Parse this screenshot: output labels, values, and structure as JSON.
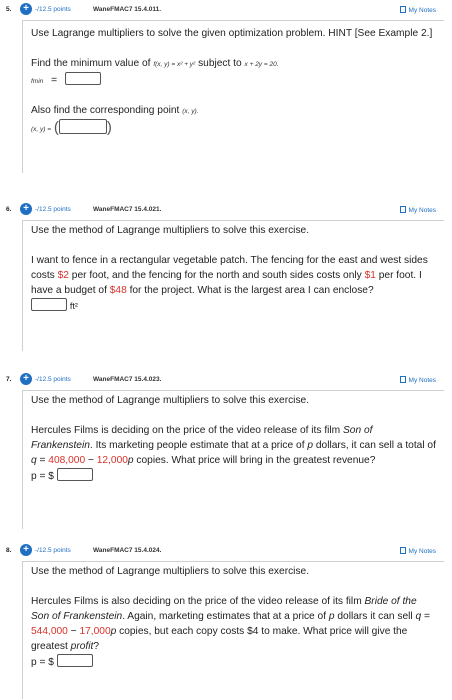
{
  "q5": {
    "num": "5.",
    "points": "-/12.5 points",
    "source": "WaneFMAC7 15.4.011.",
    "notes": "My Notes",
    "instruction": "Use Lagrange multipliers to solve the given optimization problem. HINT [See Example 2.]",
    "find_prefix": "Find the minimum value of",
    "f_expr": "f(x, y) = x² + y²",
    "subject_to": "subject to",
    "constraint": "x + 2y = 20.",
    "fmin_label": "fmin",
    "equals": "=",
    "also_find": "Also find the corresponding point",
    "point_expr": "(x, y).",
    "xy_label": "(x, y) =",
    "open_paren": "(",
    "close_paren": ")"
  },
  "q6": {
    "num": "6.",
    "points": "-/12.5 points",
    "source": "WaneFMAC7 15.4.021.",
    "notes": "My Notes",
    "instruction": "Use the method of Lagrange multipliers to solve this exercise.",
    "t1": "I want to fence in a rectangular vegetable patch. The fencing for the east and west sides costs ",
    "cost_ew": "$2",
    "t2": " per foot, and the fencing for the north and south sides costs only ",
    "cost_ns": "$1",
    "t3": " per foot. I have a budget of ",
    "budget": "$48",
    "t4": " for the project. What is the largest area I can enclose?",
    "unit": "ft²"
  },
  "q7": {
    "num": "7.",
    "points": "-/12.5 points",
    "source": "WaneFMAC7 15.4.023.",
    "notes": "My Notes",
    "instruction": "Use the method of Lagrange multipliers to solve this exercise.",
    "t1": "Hercules Films is deciding on the price of the video release of its film ",
    "film": "Son of Frankenstein",
    "t2": ". Its marketing people estimate that at a price of ",
    "p": "p",
    "t3": " dollars, it can sell a total of ",
    "q": "q",
    "eq": " = ",
    "a": "408,000",
    "minus": " − ",
    "b": "12,000",
    "t4": " copies. What price will bring in the greatest revenue?",
    "answer_label": "p = $"
  },
  "q8": {
    "num": "8.",
    "points": "-/12.5 points",
    "source": "WaneFMAC7 15.4.024.",
    "notes": "My Notes",
    "instruction": "Use the method of Lagrange multipliers to solve this exercise.",
    "t1": "Hercules Films is also deciding on the price of the video release of its film ",
    "film": "Bride of the Son of Frankenstein",
    "t2": ". Again, marketing estimates that at a price of ",
    "p": "p",
    "t3": " dollars it can sell ",
    "q": "q",
    "eq": " = ",
    "a": "544,000",
    "minus": " − ",
    "b": "17,000",
    "t4": " copies, but each copy costs $4 to make. What price will give the greatest ",
    "profit": "profit",
    "t5": "?",
    "answer_label": "p = $"
  }
}
